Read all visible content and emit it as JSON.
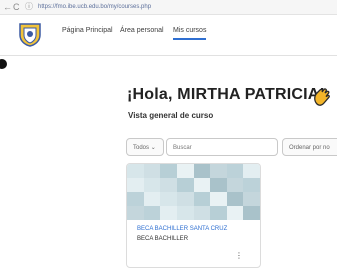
{
  "browser": {
    "back_icon": "arrow-left-icon",
    "reload_icon": "reload-icon",
    "info_icon": "info-circle-icon",
    "url": "https://fmo.ibe.ucb.edu.bo/my/courses.php"
  },
  "nav": {
    "logo_icon": "university-seal-icon",
    "items": [
      {
        "label": "Página Principal"
      },
      {
        "label": "Área personal"
      },
      {
        "label": "Mis cursos",
        "active": true
      }
    ]
  },
  "main": {
    "greeting": "¡Hola, MIRTHA PATRICIA!",
    "greeting_icon": "waving-hand-icon",
    "subtitle": "Vista general de curso",
    "filter": {
      "grouping_label": "Todos",
      "search_placeholder": "Buscar",
      "sort_label": "Ordenar por no"
    },
    "courses": [
      {
        "title": "BECA BACHILLER SANTA CRUZ",
        "category": "BECA BACHILLER",
        "menu_icon": "more-vertical-icon"
      }
    ]
  },
  "colors": {
    "accent": "#2f6fd1",
    "course_image_tones": [
      "#d7e6ea",
      "#c4d6dc",
      "#b7cfd6",
      "#e3eef1",
      "#a9c2ca",
      "#cfdfe4",
      "#bcd2d9",
      "#e9f2f4"
    ]
  }
}
